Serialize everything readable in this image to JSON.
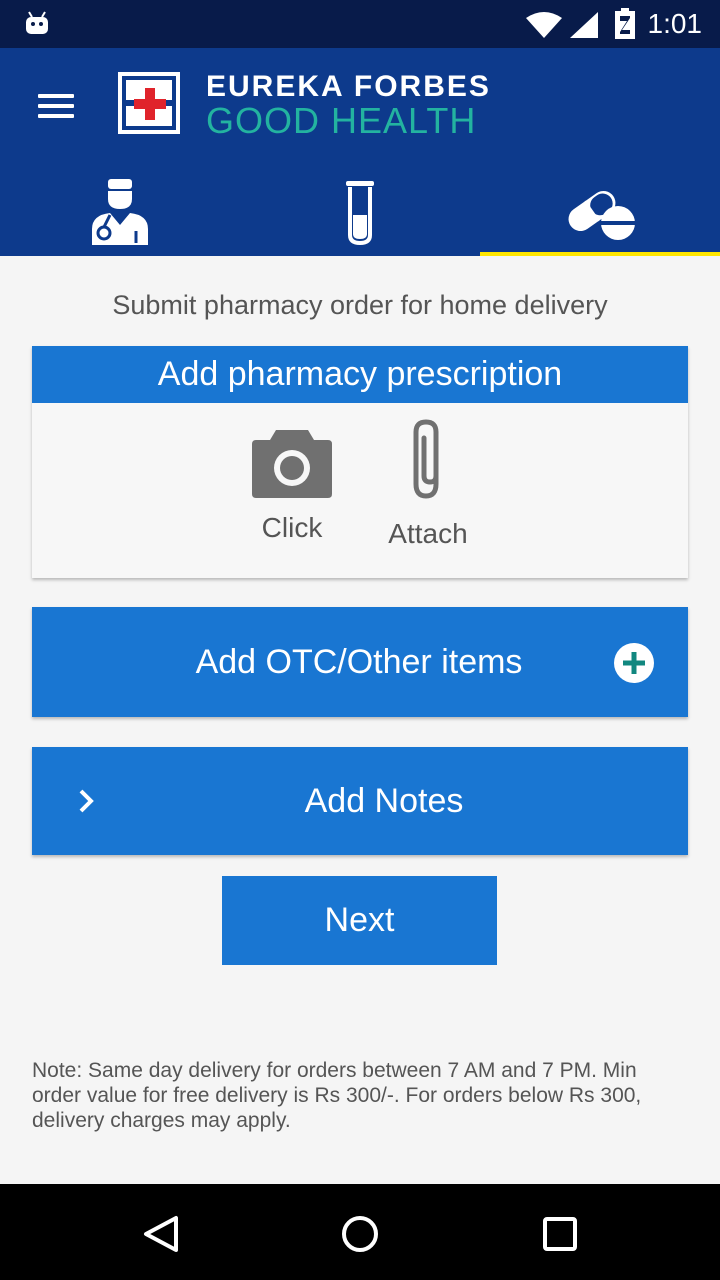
{
  "status_bar": {
    "time": "1:01",
    "icons": [
      "android-icon",
      "wifi-icon",
      "signal-icon",
      "battery-charging-icon"
    ]
  },
  "header": {
    "brand_line1": "EUREKA FORBES",
    "brand_line2": "GOOD HEALTH",
    "menu_icon": "hamburger-menu-icon",
    "tabs": [
      {
        "icon": "doctor-icon",
        "active": false
      },
      {
        "icon": "test-tube-icon",
        "active": false
      },
      {
        "icon": "pills-icon",
        "active": true
      }
    ]
  },
  "main": {
    "subtitle": "Submit pharmacy order for home delivery",
    "prescription_card": {
      "title": "Add pharmacy prescription",
      "options": [
        {
          "label": "Click",
          "icon": "camera-icon"
        },
        {
          "label": "Attach",
          "icon": "paperclip-icon"
        }
      ]
    },
    "otc_button": {
      "label": "Add OTC/Other items",
      "icon": "plus-circle-icon"
    },
    "notes_button": {
      "label": "Add Notes",
      "icon": "chevron-right-icon"
    },
    "next_button": {
      "label": "Next"
    },
    "note": "Note: Same day delivery for orders between 7 AM and 7 PM. Min order value for free delivery is Rs 300/-. For orders below Rs 300, delivery charges may apply."
  },
  "nav_bar": {
    "icons": [
      "back-icon",
      "home-icon",
      "recents-icon"
    ]
  },
  "colors": {
    "status_bar": "#081b4a",
    "header": "#0d3a8c",
    "accent_blue": "#1976d2",
    "tab_indicator": "#ffe600",
    "brand_teal": "#23b3a0"
  }
}
